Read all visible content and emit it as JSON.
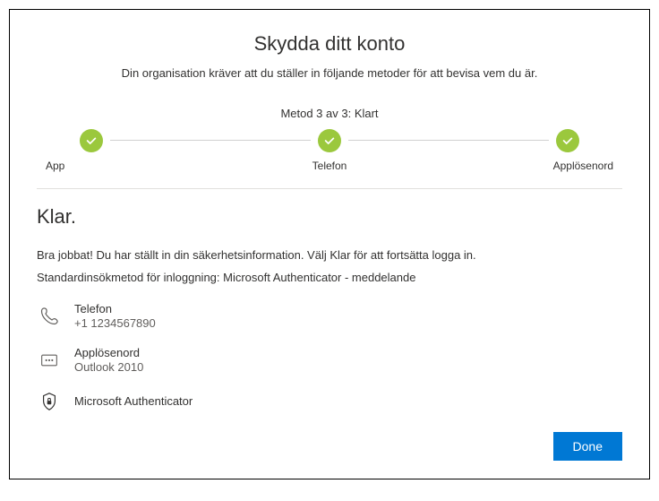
{
  "header": {
    "title": "Skydda ditt konto",
    "subtitle": "Din organisation kräver att du ställer in följande metoder för att bevisa vem du är."
  },
  "progress": {
    "label": "Metod 3 av 3: Klart",
    "steps": [
      {
        "name": "App"
      },
      {
        "name": "Telefon"
      },
      {
        "name": "Applösenord"
      }
    ]
  },
  "done": {
    "heading": "Klar.",
    "success_text": "Bra jobbat! Du har ställt in din säkerhetsinformation. Välj Klar för att fortsätta logga in.",
    "default_text": "Standardinsökmetod för inloggning: Microsoft Authenticator - meddelande"
  },
  "methods": [
    {
      "name": "Telefon",
      "detail": "+1 1234567890"
    },
    {
      "name": "Applösenord",
      "detail": "Outlook 2010"
    },
    {
      "name": "Microsoft Authenticator",
      "detail": ""
    }
  ],
  "actions": {
    "done_label": "Done"
  }
}
